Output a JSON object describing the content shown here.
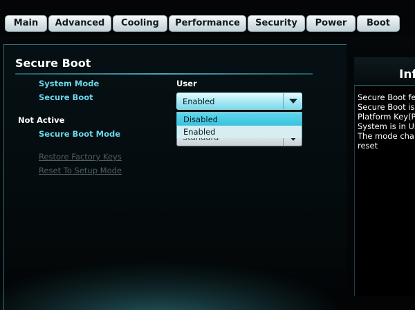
{
  "tabs": [
    {
      "label": "Main"
    },
    {
      "label": "Advanced"
    },
    {
      "label": "Cooling"
    },
    {
      "label": "Performance"
    },
    {
      "label": "Security"
    },
    {
      "label": "Power"
    },
    {
      "label": "Boot"
    }
  ],
  "section": {
    "title": "Secure Boot",
    "system_mode_label": "System Mode",
    "system_mode_value": "User",
    "secure_boot_label": "Secure Boot",
    "secure_boot_value": "Enabled",
    "status_label": "Not Active",
    "secure_boot_mode_label": "Secure Boot Mode",
    "secure_boot_mode_value": "Standard",
    "restore_factory_keys": "Restore Factory Keys",
    "reset_to_setup_mode": "Reset To Setup Mode"
  },
  "dropdown": {
    "options": [
      "Disabled",
      "Enabled"
    ],
    "highlighted": "Disabled"
  },
  "info": {
    "title": "Info",
    "lines": [
      "Secure Boot fea",
      "Secure Boot is E",
      "Platform Key(PK",
      "System is in Use",
      "The mode chan",
      "reset"
    ]
  },
  "colors": {
    "label": "#6ad7ea",
    "value": "#ffffff",
    "disabled_text": "#4d5f64",
    "dropdown_highlight": "#39c2dd"
  }
}
